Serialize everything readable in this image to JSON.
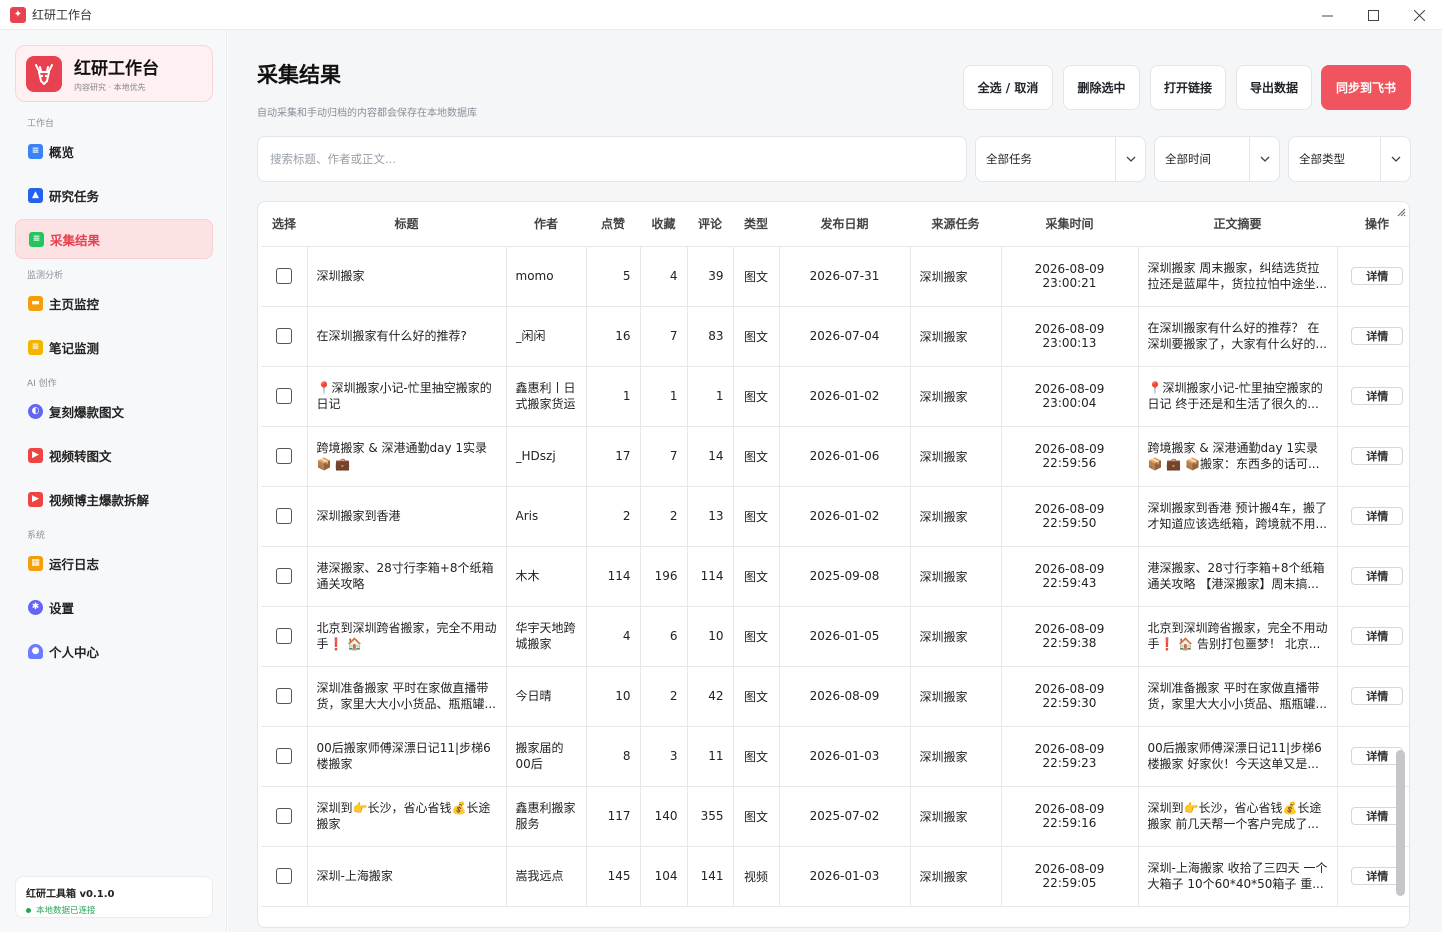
{
  "window": {
    "title": "红研工作台"
  },
  "brand": {
    "name": "红研工作台",
    "sub": "内容研究 · 本地优先"
  },
  "sidebar": {
    "sections": [
      {
        "label": "工作台"
      },
      {
        "label": "监测分析"
      },
      {
        "label": "AI 创作"
      },
      {
        "label": "系统"
      }
    ],
    "items": [
      {
        "label": "概览",
        "icon": "document-icon",
        "color": "#3b82f6"
      },
      {
        "label": "研究任务",
        "icon": "graduation-cap-icon",
        "color": "#2563eb"
      },
      {
        "label": "采集结果",
        "icon": "list-icon",
        "color": "#22c55e"
      },
      {
        "label": "主页监控",
        "icon": "folder-icon",
        "color": "#f59e0b"
      },
      {
        "label": "笔记监测",
        "icon": "note-icon",
        "color": "#f5b400"
      },
      {
        "label": "复刻爆款图文",
        "icon": "planet-icon",
        "color": "#6366f1"
      },
      {
        "label": "视频转图文",
        "icon": "play-icon",
        "color": "#ef4444"
      },
      {
        "label": "视频博主爆款拆解",
        "icon": "play-icon",
        "color": "#ef4444"
      },
      {
        "label": "运行日志",
        "icon": "calendar-icon",
        "color": "#f59e0b"
      },
      {
        "label": "设置",
        "icon": "gear-icon",
        "color": "#6366f1"
      },
      {
        "label": "个人中心",
        "icon": "user-icon",
        "color": "#6b7cff"
      }
    ],
    "version": "红研工具箱  v0.1.0",
    "status": "本地数据已连接"
  },
  "page": {
    "title": "采集结果",
    "subtitle": "自动采集和手动归档的内容都会保存在本地数据库"
  },
  "toolbar": {
    "select_all": "全选 / 取消",
    "delete_selected": "删除选中",
    "open_link": "打开链接",
    "export": "导出数据",
    "sync": "同步到飞书",
    "accent": "#f0555f"
  },
  "filters": {
    "search_placeholder": "搜索标题、作者或正文...",
    "task": "全部任务",
    "time": "全部时间",
    "type": "全部类型"
  },
  "table": {
    "columns": [
      "选择",
      "标题",
      "作者",
      "点赞",
      "收藏",
      "评论",
      "类型",
      "发布日期",
      "来源任务",
      "采集时间",
      "正文摘要",
      "操作"
    ],
    "detail_label": "详情",
    "rows": [
      {
        "title": "深圳搬家",
        "author": "momo",
        "likes": "5",
        "favs": "4",
        "comments": "39",
        "type": "图文",
        "date": "2026-07-31",
        "task": "深圳搬家",
        "collected": "2026-08-09 23:00:21",
        "summary": "深圳搬家 周末搬家，纠结选货拉拉还是蓝犀牛，货拉拉怕中途坐..."
      },
      {
        "title": "在深圳搬家有什么好的推荐?",
        "author": "_闲闲",
        "likes": "16",
        "favs": "7",
        "comments": "83",
        "type": "图文",
        "date": "2026-07-04",
        "task": "深圳搬家",
        "collected": "2026-08-09 23:00:13",
        "summary": "在深圳搬家有什么好的推荐？ 在深圳要搬家了，大家有什么好的..."
      },
      {
        "title": "📍深圳搬家小记-忙里抽空搬家的日记",
        "author": "鑫惠利丨日式搬家货运",
        "likes": "1",
        "favs": "1",
        "comments": "1",
        "type": "图文",
        "date": "2026-01-02",
        "task": "深圳搬家",
        "collected": "2026-08-09 23:00:04",
        "summary": "📍深圳搬家小记-忙里抽空搬家的日记 终于还是和生活了很久的..."
      },
      {
        "title": "跨境搬家 & 深港通勤day 1实录 📦 💼",
        "author": "_HDszj",
        "likes": "17",
        "favs": "7",
        "comments": "14",
        "type": "图文",
        "date": "2026-01-06",
        "task": "深圳搬家",
        "collected": "2026-08-09 22:59:56",
        "summary": "跨境搬家 & 深港通勤day 1实录 📦 💼 📦搬家：东西多的话可..."
      },
      {
        "title": "深圳搬家到香港",
        "author": "Aris",
        "likes": "2",
        "favs": "2",
        "comments": "13",
        "type": "图文",
        "date": "2026-01-02",
        "task": "深圳搬家",
        "collected": "2026-08-09 22:59:50",
        "summary": "深圳搬家到香港 预计搬4车，搬了才知道应该选纸箱，跨境就不用..."
      },
      {
        "title": "港深搬家、28寸行李箱+8个纸箱通关攻略",
        "author": "木木",
        "likes": "114",
        "favs": "196",
        "comments": "114",
        "type": "图文",
        "date": "2025-09-08",
        "task": "深圳搬家",
        "collected": "2026-08-09 22:59:43",
        "summary": "港深搬家、28寸行李箱+8个纸箱通关攻略 【港深搬家】周末搞..."
      },
      {
        "title": "北京到深圳跨省搬家，完全不用动手❗ 🏠",
        "author": "华宇天地跨城搬家",
        "likes": "4",
        "favs": "6",
        "comments": "10",
        "type": "图文",
        "date": "2026-01-05",
        "task": "深圳搬家",
        "collected": "2026-08-09 22:59:38",
        "summary": "北京到深圳跨省搬家，完全不用动手❗ 🏠 告别打包噩梦！ 北京..."
      },
      {
        "title": "深圳准备搬家 平时在家做直播带货，家里大大小小货品、瓶瓶罐...",
        "author": "今日晴",
        "likes": "10",
        "favs": "2",
        "comments": "42",
        "type": "图文",
        "date": "2026-08-09",
        "task": "深圳搬家",
        "collected": "2026-08-09 22:59:30",
        "summary": "深圳准备搬家 平时在家做直播带货，家里大大小小货品、瓶瓶罐..."
      },
      {
        "title": "00后搬家师傅深漂日记11|步梯6楼搬家",
        "author": "搬家届的00后",
        "likes": "8",
        "favs": "3",
        "comments": "11",
        "type": "图文",
        "date": "2026-01-03",
        "task": "深圳搬家",
        "collected": "2026-08-09 22:59:23",
        "summary": "00后搬家师傅深漂日记11|步梯6楼搬家 好家伙！今天这单又是..."
      },
      {
        "title": "深圳到👉长沙，省心省钱💰长途搬家",
        "author": "鑫惠利搬家服务",
        "likes": "117",
        "favs": "140",
        "comments": "355",
        "type": "图文",
        "date": "2025-07-02",
        "task": "深圳搬家",
        "collected": "2026-08-09 22:59:16",
        "summary": "深圳到👉长沙，省心省钱💰长途搬家 前几天帮一个客户完成了..."
      },
      {
        "title": "深圳-上海搬家",
        "author": "嵩我远点",
        "likes": "145",
        "favs": "104",
        "comments": "141",
        "type": "视频",
        "date": "2026-01-03",
        "task": "深圳搬家",
        "collected": "2026-08-09 22:59:05",
        "summary": "深圳-上海搬家 收拾了三四天 一个大箱子 10个60*40*50箱子 重..."
      }
    ]
  }
}
